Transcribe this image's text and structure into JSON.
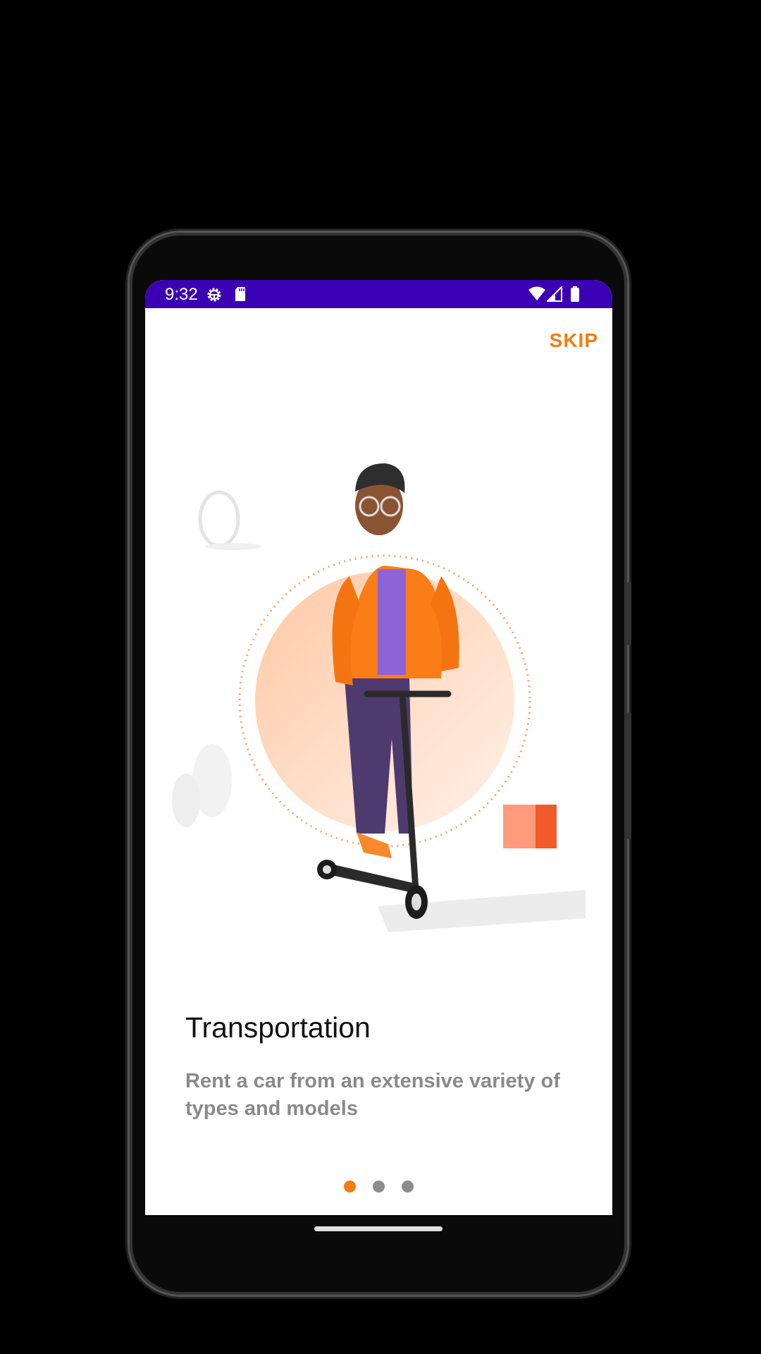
{
  "status_bar": {
    "time": "9:32",
    "icons": [
      "settings-icon",
      "sd-card-icon",
      "wifi-icon",
      "signal-icon",
      "battery-icon"
    ]
  },
  "onboarding": {
    "skip_label": "SKIP",
    "title": "Transportation",
    "description": "Rent a car from an extensive variety of types and models",
    "page_index": 0,
    "page_count": 3
  },
  "colors": {
    "accent": "#f47c12",
    "status_bar": "#3c00b4",
    "description": "#8a8a8a"
  }
}
